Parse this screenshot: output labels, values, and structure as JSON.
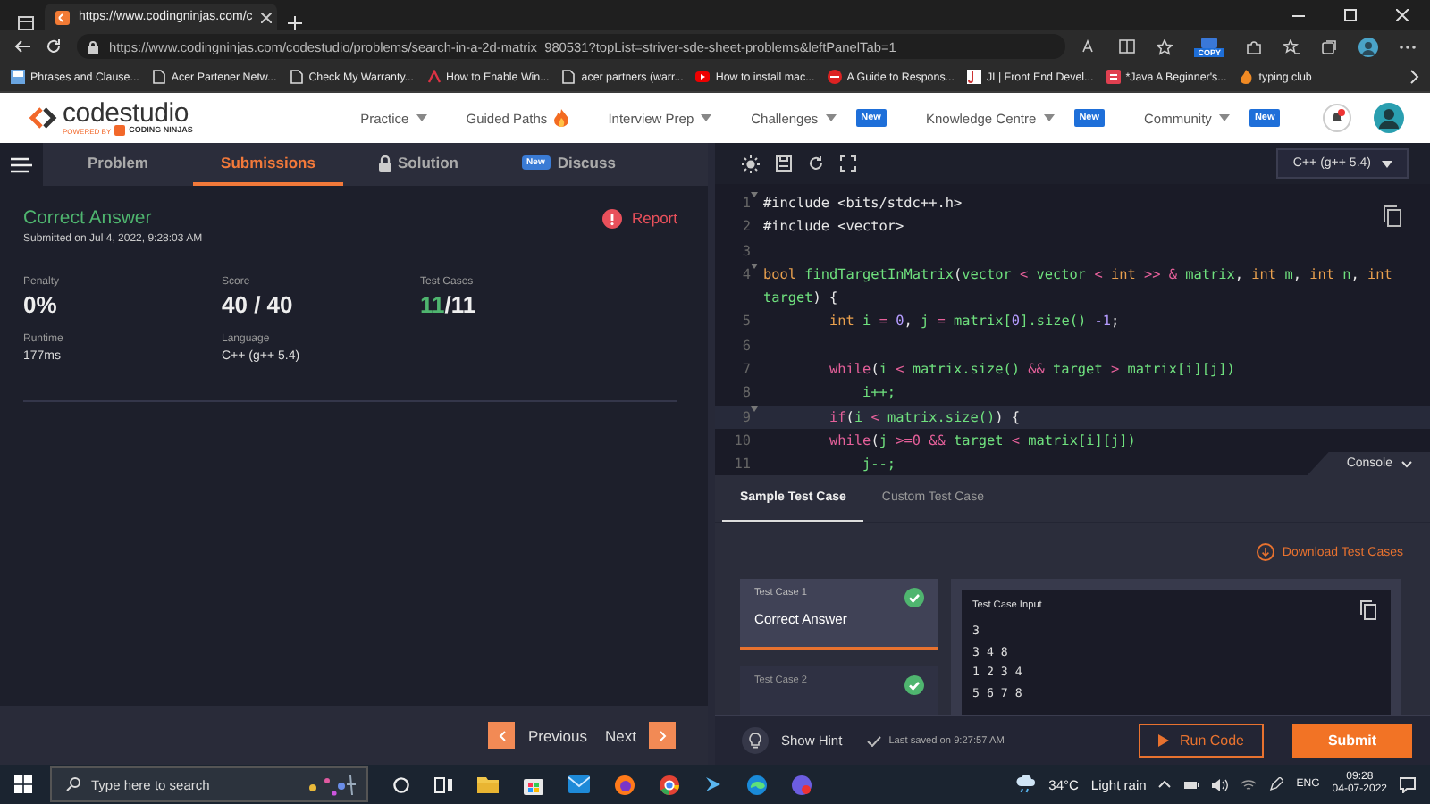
{
  "browser": {
    "tab_title": "https://www.codingninjas.com/c",
    "url": "https://www.codingninjas.com/codestudio/problems/search-in-a-2d-matrix_980531?topList=striver-sde-sheet-problems&leftPanelTab=1",
    "extension_badge": "COPY",
    "bookmarks": [
      "Phrases and Clause...",
      "Acer Partener Netw...",
      "Check My Warranty...",
      "How to Enable Win...",
      "acer partners (warr...",
      "How to install mac...",
      "A Guide to Respons...",
      "JI | Front End Devel...",
      "*Java A Beginner's...",
      "typing club"
    ]
  },
  "site": {
    "logo": {
      "word1": "code",
      "word2": "studio",
      "powered": "POWERED BY",
      "brand": "CODING NINJAS"
    },
    "nav": [
      {
        "label": "Practice",
        "menu": true,
        "hot": false
      },
      {
        "label": "Guided Paths",
        "menu": false,
        "hot": true
      },
      {
        "label": "Interview Prep",
        "menu": true,
        "hot": false
      },
      {
        "label": "Challenges",
        "menu": true,
        "hot": false,
        "badge": "New"
      },
      {
        "label": "Knowledge Centre",
        "menu": true,
        "hot": false,
        "badge": "New"
      },
      {
        "label": "Community",
        "menu": true,
        "hot": false,
        "badge": "New"
      }
    ]
  },
  "left_tabs": [
    {
      "label": "Problem",
      "selected": false,
      "locked": false
    },
    {
      "label": "Submissions",
      "selected": true,
      "locked": false
    },
    {
      "label": "Solution",
      "selected": false,
      "locked": true
    },
    {
      "label": "Discuss",
      "selected": false,
      "locked": false,
      "badge": "New"
    }
  ],
  "submission": {
    "status": "Correct Answer",
    "submitted": "Submitted on Jul 4, 2022, 9:28:03 AM",
    "report": "Report",
    "stats": [
      {
        "label": "Penalty",
        "value": "0%",
        "kind": "big"
      },
      {
        "label": "Score",
        "value": "40 / 40",
        "kind": "big"
      },
      {
        "label": "Test Cases",
        "passed": "11",
        "total": "/11",
        "kind": "ratio"
      },
      {
        "label": "Runtime",
        "value": "177ms",
        "kind": "small"
      },
      {
        "label": "Language",
        "value": "C++ (g++ 5.4)",
        "kind": "small"
      }
    ]
  },
  "pager": {
    "previous": "Previous",
    "next": "Next"
  },
  "editor": {
    "language": "C++ (g++ 5.4)",
    "console": "Console",
    "lines": [
      {
        "number": "1",
        "fold": true,
        "active": false,
        "tokens": [
          {
            "kind": "punct",
            "text": "#include <bits/stdc++.h>"
          }
        ]
      },
      {
        "number": "2",
        "fold": false,
        "active": false,
        "tokens": [
          {
            "kind": "punct",
            "text": "#include <vector>"
          }
        ]
      },
      {
        "number": "3",
        "fold": false,
        "active": false
      },
      {
        "number": "4",
        "fold": true,
        "active": false,
        "tokens": [
          {
            "kind": "type",
            "text": "bool "
          },
          {
            "kind": "name",
            "text": "findTargetInMatrix"
          },
          {
            "kind": "punct",
            "text": "("
          },
          {
            "kind": "name",
            "text": "vector "
          },
          {
            "kind": "op",
            "text": "< "
          },
          {
            "kind": "name",
            "text": "vector "
          },
          {
            "kind": "op",
            "text": "< "
          },
          {
            "kind": "type",
            "text": "int "
          },
          {
            "kind": "op",
            "text": ">> & "
          },
          {
            "kind": "name",
            "text": "matrix"
          },
          {
            "kind": "punct",
            "text": ", "
          },
          {
            "kind": "type",
            "text": "int "
          },
          {
            "kind": "name",
            "text": "m"
          },
          {
            "kind": "punct",
            "text": ", "
          },
          {
            "kind": "type",
            "text": "int "
          },
          {
            "kind": "name",
            "text": "n"
          },
          {
            "kind": "punct",
            "text": ", "
          },
          {
            "kind": "type",
            "text": "int "
          },
          {
            "kind": "name",
            "text": "target"
          },
          {
            "kind": "punct",
            "text": ") {"
          }
        ]
      },
      {
        "number": "5",
        "fold": false,
        "active": false,
        "tokens": [
          {
            "kind": "type",
            "text": "        int "
          },
          {
            "kind": "name",
            "text": "i "
          },
          {
            "kind": "op",
            "text": "= "
          },
          {
            "kind": "num",
            "text": "0"
          },
          {
            "kind": "punct",
            "text": ", "
          },
          {
            "kind": "name",
            "text": "j "
          },
          {
            "kind": "op",
            "text": "= "
          },
          {
            "kind": "name",
            "text": "matrix["
          },
          {
            "kind": "num",
            "text": "0"
          },
          {
            "kind": "name",
            "text": "].size() "
          },
          {
            "kind": "num",
            "text": "-1"
          },
          {
            "kind": "punct",
            "text": ";"
          }
        ]
      },
      {
        "number": "6",
        "fold": false,
        "active": false
      },
      {
        "number": "7",
        "fold": false,
        "active": false,
        "tokens": [
          {
            "kind": "op",
            "text": "        while"
          },
          {
            "kind": "punct",
            "text": "("
          },
          {
            "kind": "name",
            "text": "i "
          },
          {
            "kind": "op",
            "text": "< "
          },
          {
            "kind": "name",
            "text": "matrix.size() "
          },
          {
            "kind": "op",
            "text": "&& "
          },
          {
            "kind": "name",
            "text": "target "
          },
          {
            "kind": "op",
            "text": "> "
          },
          {
            "kind": "name",
            "text": "matrix[i][j])"
          }
        ]
      },
      {
        "number": "8",
        "fold": false,
        "active": false,
        "tokens": [
          {
            "kind": "name",
            "text": "            i++;"
          }
        ]
      },
      {
        "number": "9",
        "fold": true,
        "active": true,
        "tokens": [
          {
            "kind": "op",
            "text": "        if"
          },
          {
            "kind": "punct",
            "text": "("
          },
          {
            "kind": "name",
            "text": "i "
          },
          {
            "kind": "op",
            "text": "< "
          },
          {
            "kind": "name",
            "text": "matrix.size()"
          },
          {
            "kind": "punct",
            "text": ") {"
          }
        ]
      },
      {
        "number": "10",
        "fold": false,
        "active": false,
        "tokens": [
          {
            "kind": "op",
            "text": "        while"
          },
          {
            "kind": "punct",
            "text": "("
          },
          {
            "kind": "name",
            "text": "j "
          },
          {
            "kind": "op",
            "text": ">=0 && "
          },
          {
            "kind": "name",
            "text": "target "
          },
          {
            "kind": "op",
            "text": "< "
          },
          {
            "kind": "name",
            "text": "matrix[i][j])"
          }
        ]
      },
      {
        "number": "11",
        "fold": false,
        "active": false,
        "tokens": [
          {
            "kind": "name",
            "text": "            j--;"
          }
        ]
      }
    ]
  },
  "tests": {
    "tabs": [
      {
        "label": "Sample Test Case",
        "selected": true
      },
      {
        "label": "Custom Test Case",
        "selected": false
      }
    ],
    "download": "Download Test Cases",
    "cases": [
      {
        "label": "Test Case 1",
        "result": "Correct Answer",
        "passed": true,
        "selected": true
      },
      {
        "label": "Test Case 2",
        "passed": true,
        "selected": false
      }
    ],
    "input_title": "Test Case Input",
    "input_lines": [
      "3",
      "3 4 8",
      "1 2 3 4",
      "5 6 7 8"
    ]
  },
  "footer": {
    "hint": "Show Hint",
    "saved": "Last saved on 9:27:57 AM",
    "run": "Run Code",
    "submit": "Submit"
  },
  "taskbar": {
    "search_placeholder": "Type here to search",
    "temperature": "34°C",
    "weather": "Light rain",
    "language": "ENG",
    "time": "09:28",
    "date": "04-07-2022"
  }
}
